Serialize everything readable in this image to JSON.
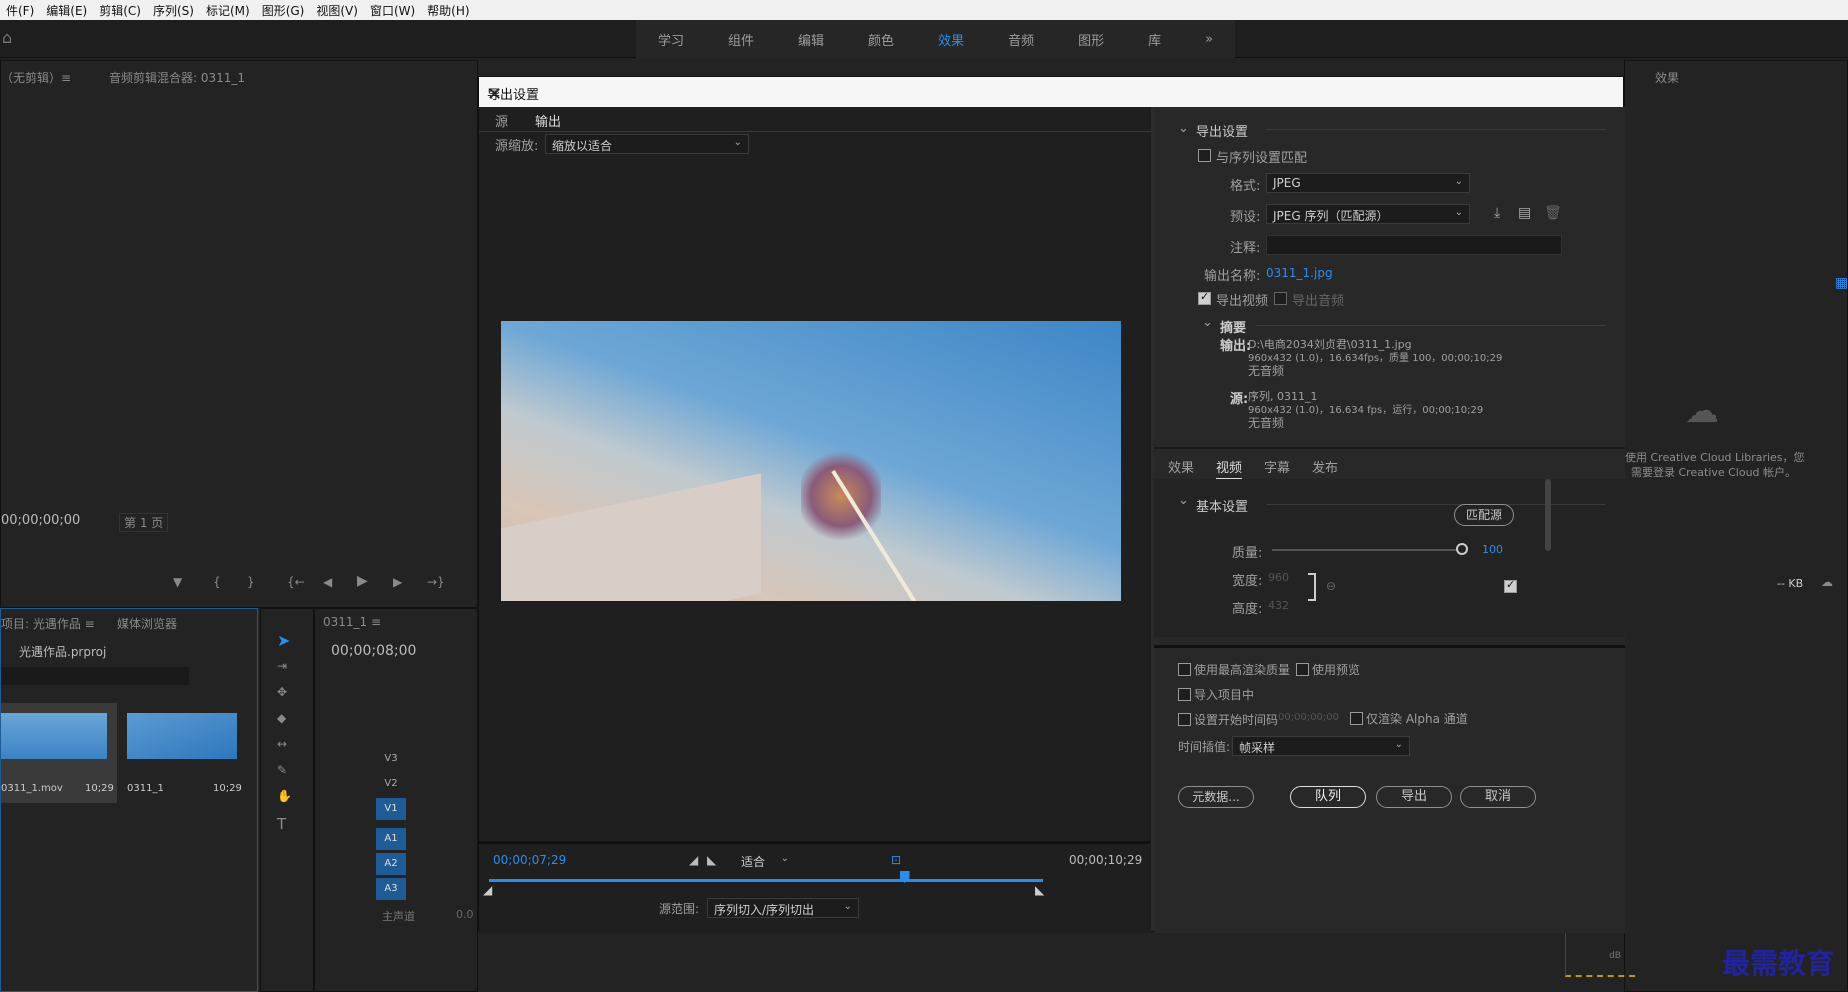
{
  "menu": [
    "件(F)",
    "编辑(E)",
    "剪辑(C)",
    "序列(S)",
    "标记(M)",
    "图形(G)",
    "视图(V)",
    "窗口(W)",
    "帮助(H)"
  ],
  "workspaces": [
    {
      "label": "学习"
    },
    {
      "label": "组件"
    },
    {
      "label": "编辑"
    },
    {
      "label": "颜色"
    },
    {
      "label": "效果",
      "active": true
    },
    {
      "label": "音频"
    },
    {
      "label": "图形"
    },
    {
      "label": "库"
    }
  ],
  "bg": {
    "source_tab": "（无剪辑）≡",
    "mixer_tab": "音频剪辑混合器: 0311_1",
    "source_timecode": "00;00;00;00",
    "page_label": "第 1 页",
    "project_tab": "项目: 光遇作品 ≡",
    "media_tab": "媒体浏览器",
    "project_file": "光遇作品.prproj",
    "clips": [
      {
        "name": "0311_1.mov",
        "dur": "10;29"
      },
      {
        "name": "0311_1",
        "dur": "10;29"
      }
    ],
    "seq_tab": "0311_1 ≡",
    "seq_timecode": "00;00;08;00",
    "tracks": [
      {
        "name": "V3",
        "on": false
      },
      {
        "name": "V2",
        "on": false
      },
      {
        "name": "V1",
        "on": true
      },
      {
        "name": "A1",
        "on": true
      },
      {
        "name": "A2",
        "on": true
      },
      {
        "name": "A3",
        "on": true
      }
    ],
    "master_track": "主声道",
    "master_value": "0.0",
    "cc_text1": "使用 Creative Cloud Libraries，您",
    "cc_text2": "需要登录 Creative Cloud 帐户。",
    "kb_label": "-- KB",
    "db_label": "dB",
    "fx_tab": "效果",
    "watermark": "最需教育"
  },
  "dialog": {
    "title": "导出设置",
    "tabs": [
      "源",
      "输出"
    ],
    "active_tab": "输出",
    "source_scale_label": "源缩放:",
    "source_scale_value": "缩放以适合",
    "current_time": "00;00;07;29",
    "fit_value": "适合",
    "end_time": "00;00;10;29",
    "source_range_label": "源范围:",
    "source_range_value": "序列切入/序列切出",
    "playhead_fraction": 0.75,
    "export": {
      "section": "导出设置",
      "match_seq": "与序列设置匹配",
      "format_label": "格式:",
      "format_value": "JPEG",
      "preset_label": "预设:",
      "preset_value": "JPEG 序列（匹配源）",
      "comment_label": "注释:",
      "output_name_label": "输出名称:",
      "output_name_value": "0311_1.jpg",
      "export_video": "导出视频",
      "export_audio": "导出音频",
      "summary_label": "摘要",
      "output_key": "输出:",
      "output_line1": "D:\\电商2034刘贞君\\0311_1.jpg",
      "output_line2": "960x432 (1.0)，16.634fps，质量 100，00;00;10;29",
      "output_line3": "无音频",
      "source_key": "源:",
      "source_line1": "序列, 0311_1",
      "source_line2": "960x432 (1.0)，16.634 fps，运行，00;00;10;29",
      "source_line3": "无音频"
    },
    "settings_tabs": [
      "效果",
      "视频",
      "字幕",
      "发布"
    ],
    "settings_active": "视频",
    "basic": {
      "section": "基本设置",
      "match_source": "匹配源",
      "quality_label": "质量:",
      "quality_value": "100",
      "quality_fraction": 1.0,
      "width_label": "宽度:",
      "width_value": "960",
      "height_label": "高度:",
      "height_value": "432"
    },
    "bottom": {
      "max_quality": "使用最高渲染质量",
      "use_preview": "使用预览",
      "import_project": "导入项目中",
      "set_start_tc": "设置开始时间码",
      "start_tc_value": "00;00;00;00",
      "alpha_only": "仅渲染 Alpha 通道",
      "interp_label": "时间插值:",
      "interp_value": "帧采样",
      "metadata_btn": "元数据...",
      "queue_btn": "队列",
      "export_btn": "导出",
      "cancel_btn": "取消"
    }
  }
}
